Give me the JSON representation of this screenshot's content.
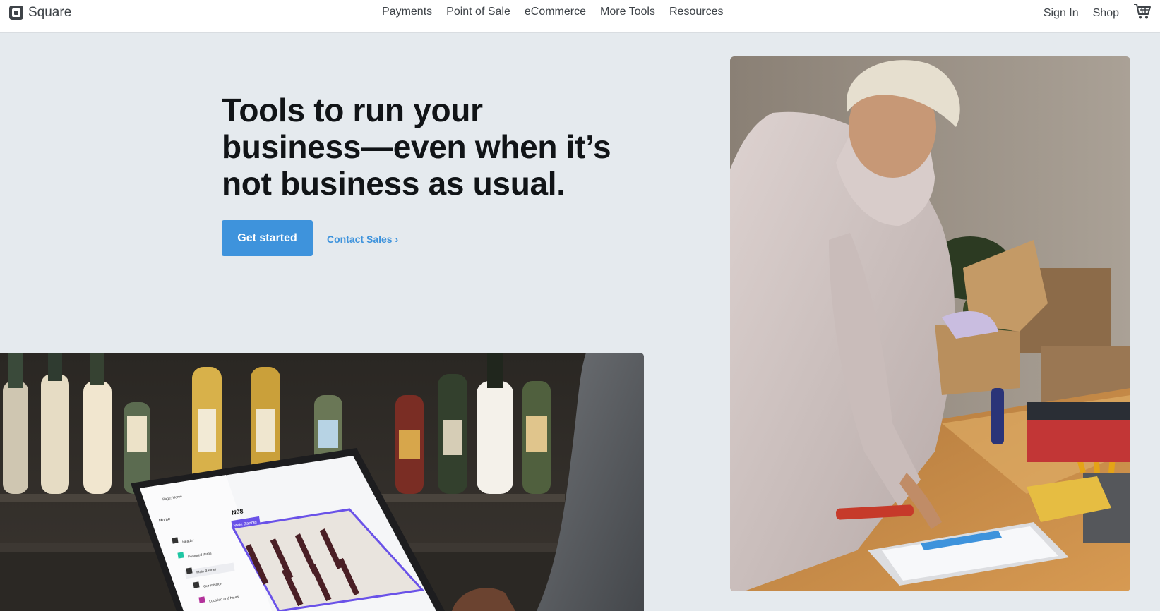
{
  "brand": {
    "name": "Square",
    "icon": "square-logo-icon"
  },
  "nav": {
    "items": [
      {
        "label": "Payments"
      },
      {
        "label": "Point of Sale"
      },
      {
        "label": "eCommerce"
      },
      {
        "label": "More Tools"
      },
      {
        "label": "Resources"
      }
    ],
    "sign_in": "Sign In",
    "shop": "Shop",
    "cart_icon": "cart-icon"
  },
  "hero": {
    "title": "Tools to run your business—even when it’s not business as usual.",
    "primary_cta": "Get started",
    "secondary_cta": "Contact Sales ›"
  },
  "images": {
    "left": "laptop-wine-shop-photo",
    "right": "woman-packing-box-photo"
  },
  "laptop_screen": {
    "title": "N98",
    "banner_label": "Main Banner",
    "page_select": "Page: Home",
    "home": "Home",
    "sidebar_items": [
      "Header",
      "Featured Items",
      "Main Banner",
      "Our mission",
      "Location and hours"
    ]
  },
  "colors": {
    "accent": "#3e93dc",
    "background": "#e5eaee",
    "text": "#111417"
  }
}
